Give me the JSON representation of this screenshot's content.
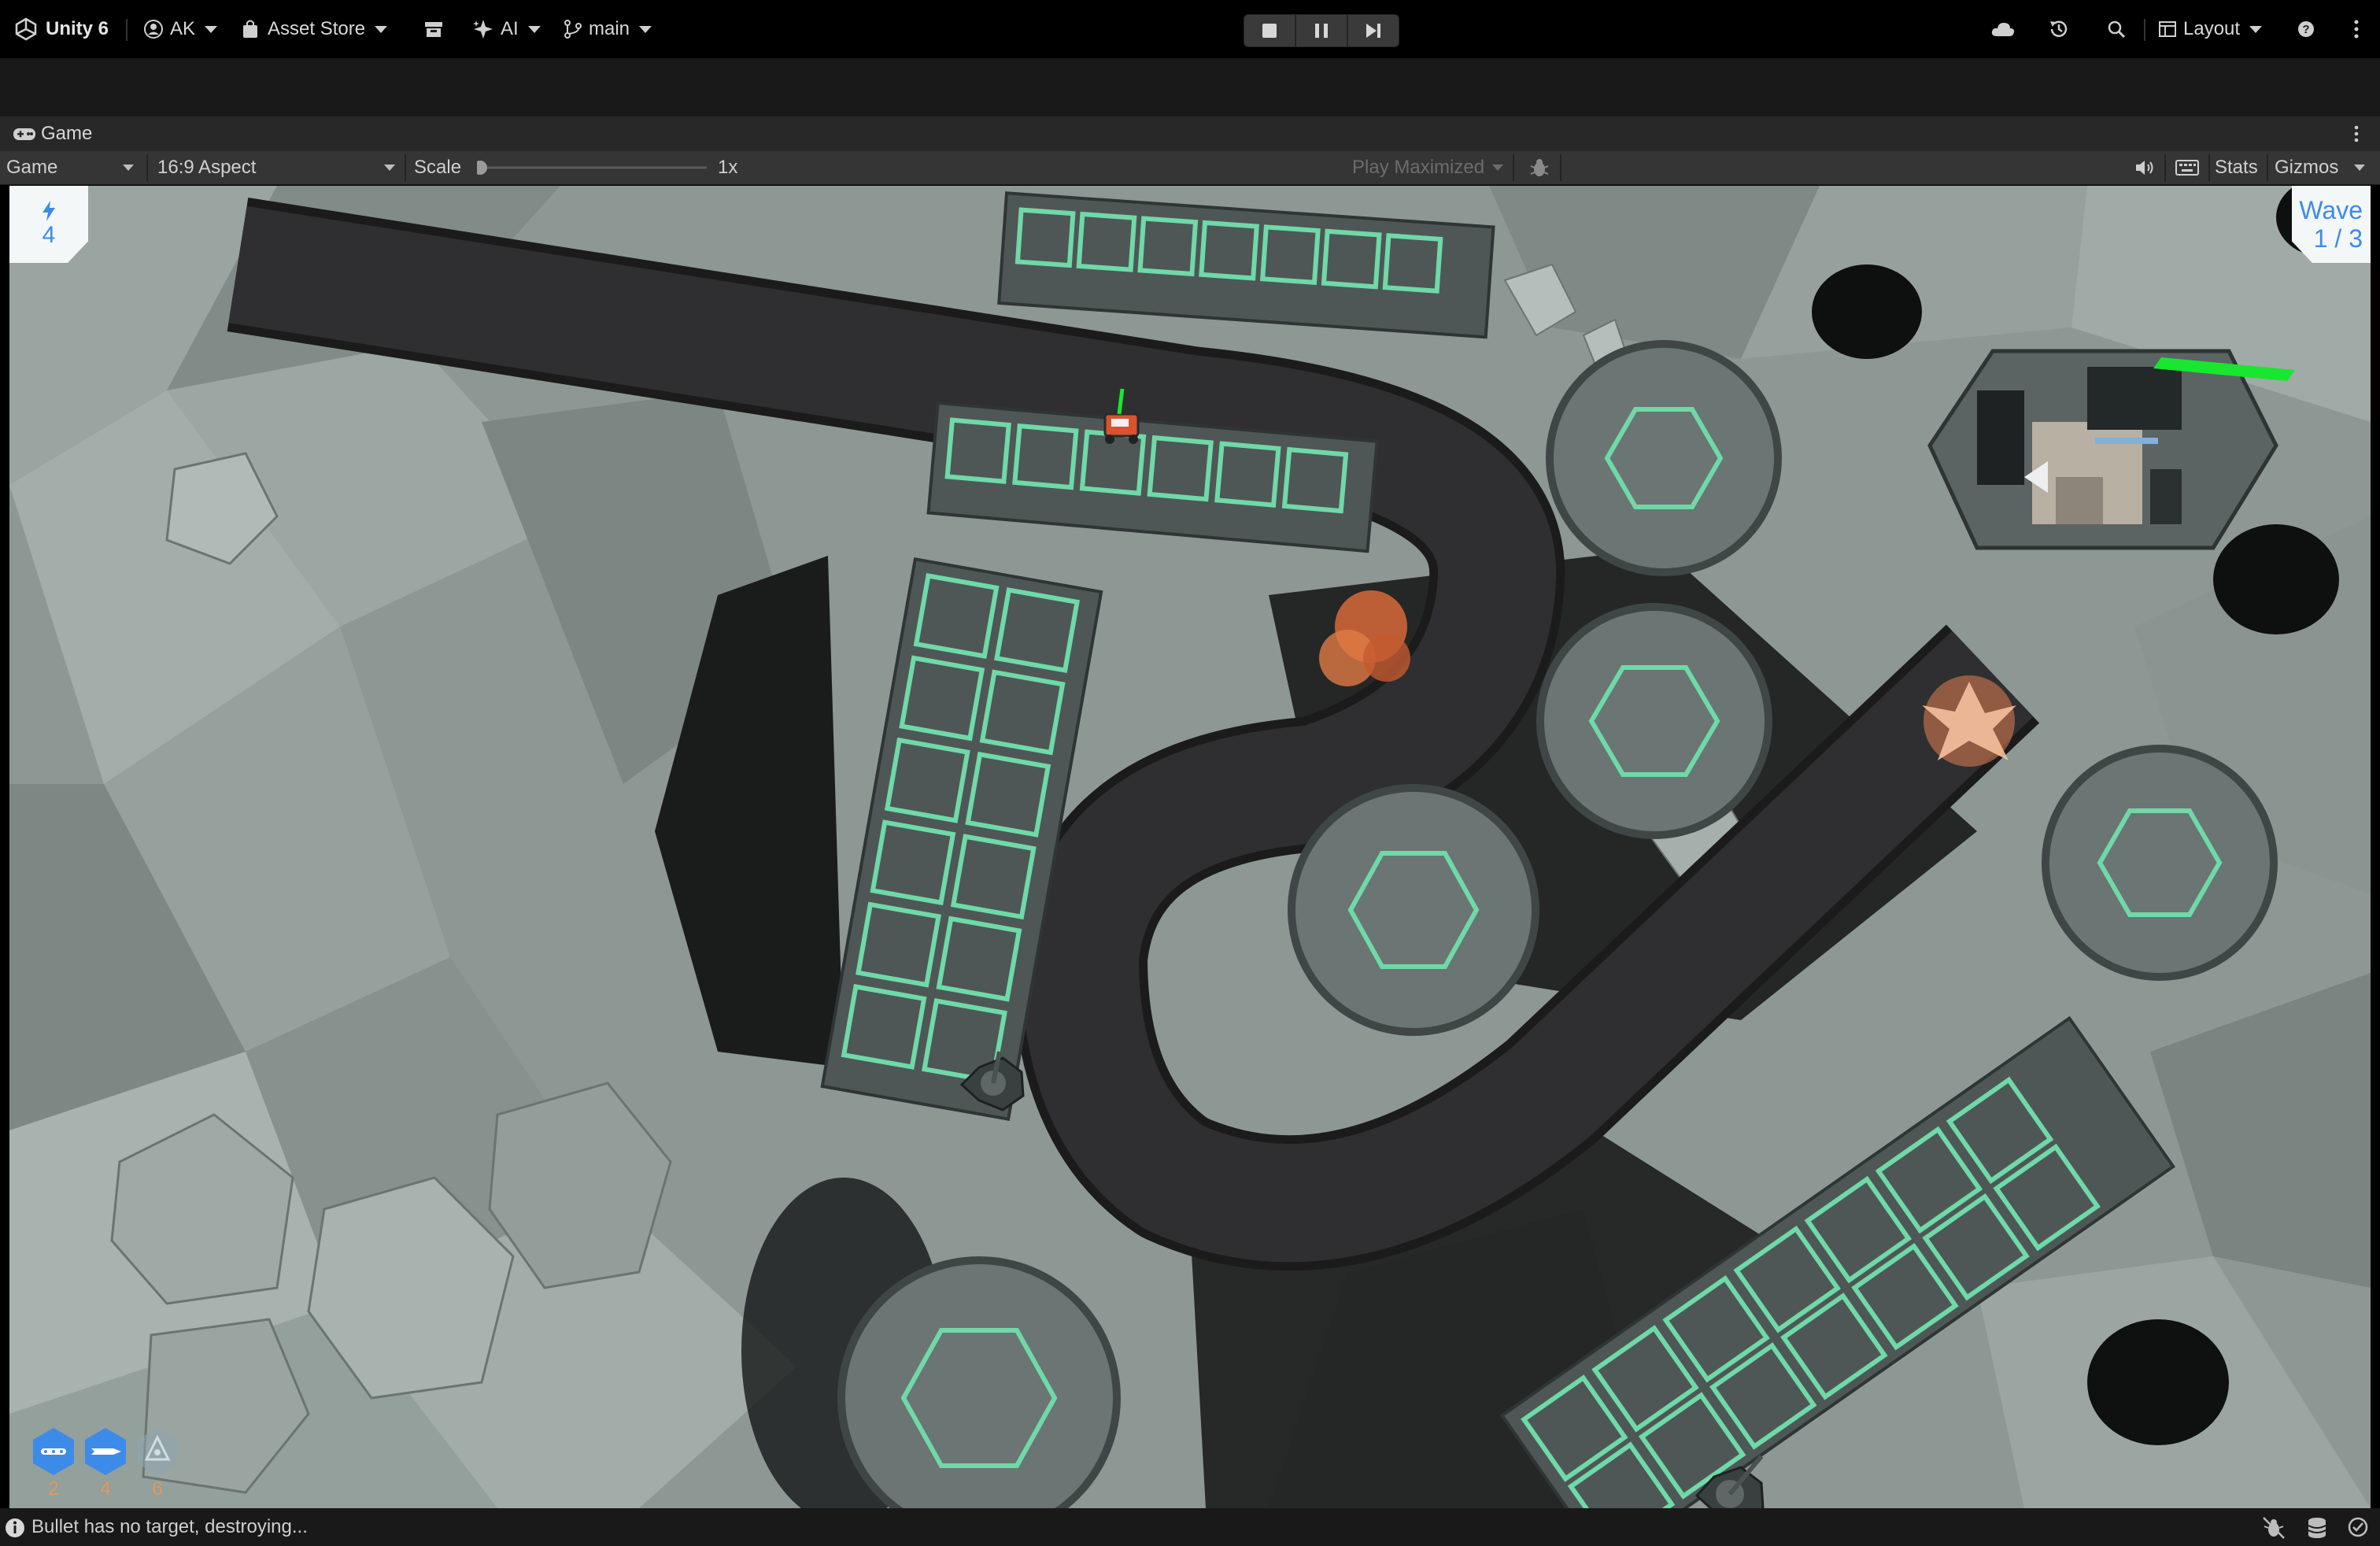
{
  "toolbar": {
    "product": "Unity 6",
    "account": "AK",
    "asset_store": "Asset Store",
    "ai": "AI",
    "branch": "main",
    "layout": "Layout"
  },
  "tab": {
    "title": "Game"
  },
  "game_bar": {
    "display": "Game",
    "aspect": "16:9 Aspect",
    "scale_label": "Scale",
    "scale_value": "1x",
    "scale_level": 0,
    "play_maximized": "Play Maximized",
    "stats": "Stats",
    "gizmos": "Gizmos"
  },
  "hud": {
    "energy": "4",
    "wave_label": "Wave",
    "wave_value": "1 / 3",
    "towers": [
      {
        "name": "gatling-tower",
        "cost": "2"
      },
      {
        "name": "rocket-tower",
        "cost": "4"
      },
      {
        "name": "radiation-tower",
        "cost": "6"
      }
    ],
    "base_health": 1.0
  },
  "status": {
    "message": "Bullet has no target, destroying..."
  },
  "colors": {
    "accent_blue": "#3d8be8",
    "tile_green": "#6fd9a8",
    "health_green": "#19e62f",
    "road": "#2f2f31",
    "terrain": "#8b9693",
    "cost_orange": "#e09a5c"
  }
}
